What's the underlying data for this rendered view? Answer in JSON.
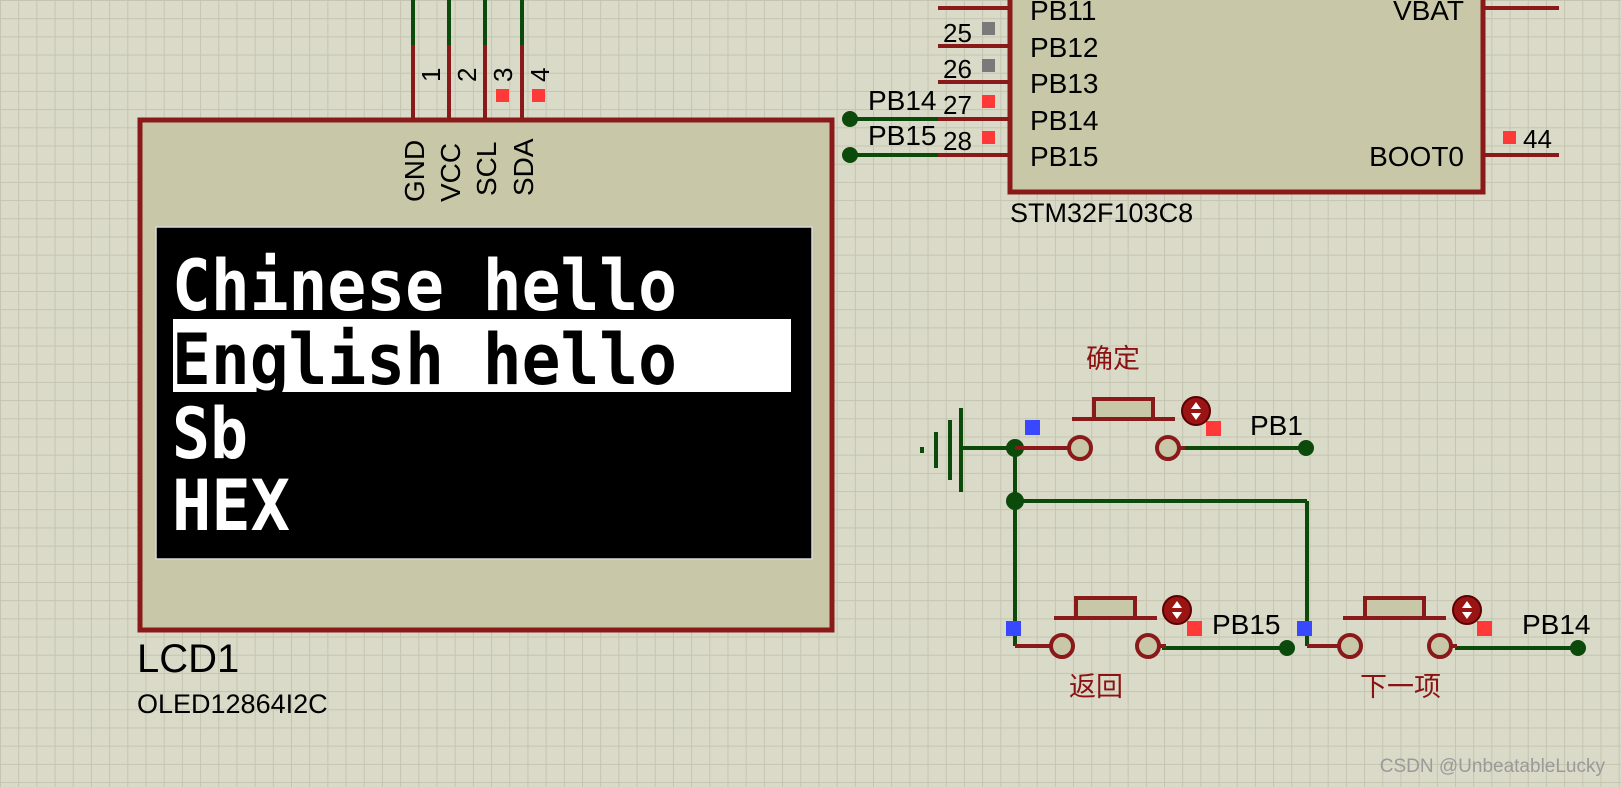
{
  "oled": {
    "reference": "LCD1",
    "part": "OLED12864I2C",
    "pins": [
      "GND",
      "VCC",
      "SCL",
      "SDA"
    ],
    "pin_numbers": [
      "1",
      "2",
      "3",
      "4"
    ],
    "menu_items": [
      "Chinese hello",
      "English hello",
      "Sb",
      "HEX"
    ],
    "selected_index": 1
  },
  "mcu": {
    "part": "STM32F103C8",
    "left_pins": [
      {
        "num": "25",
        "label": "PB12"
      },
      {
        "num": "26",
        "label": "PB13"
      },
      {
        "num": "27",
        "label": "PB14"
      },
      {
        "num": "28",
        "label": "PB15"
      }
    ],
    "top_left_label": "PB11",
    "top_right_label": "VBAT",
    "boot_label": "BOOT0",
    "boot_num": "44",
    "net_labels": [
      "PB14",
      "PB15"
    ]
  },
  "buttons": [
    {
      "label": "确定",
      "net": "PB1"
    },
    {
      "label": "返回",
      "net": "PB15"
    },
    {
      "label": "下一项",
      "net": "PB14"
    }
  ],
  "watermark": "CSDN @UnbeatableLucky",
  "colors": {
    "body": "#c8c8a8",
    "outline": "#8a1a1a",
    "wire": "#0c4a0c",
    "pin_red": "#ff3838",
    "pin_blue": "#3848ff",
    "label_cn": "#8a1212"
  }
}
